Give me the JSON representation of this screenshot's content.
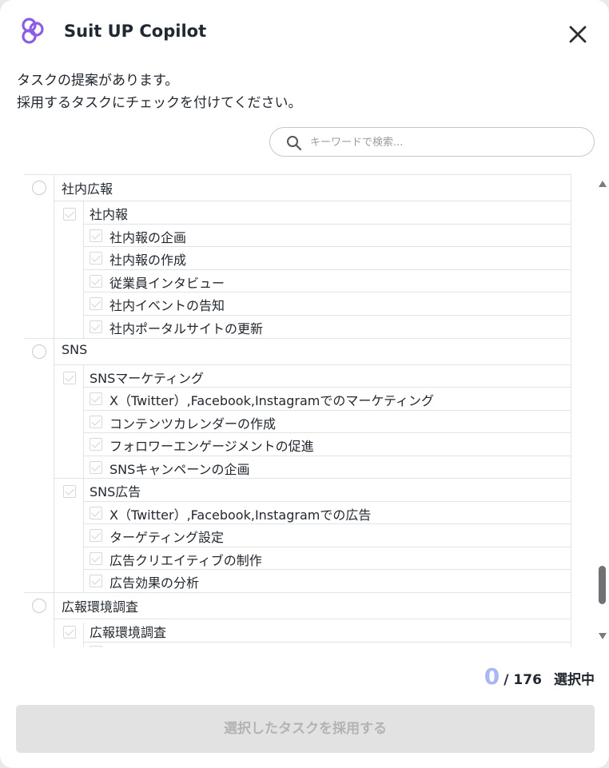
{
  "header": {
    "app_title": "Suit UP Copilot",
    "logo_icon": "suitup-logo-icon",
    "close_icon": "close-icon",
    "brand_color": "#8b5ce6"
  },
  "intro": {
    "line1": "タスクの提案があります。",
    "line2": "採用するタスクにチェックを付けてください。"
  },
  "search": {
    "placeholder": "キーワードで検索...",
    "value": ""
  },
  "categories": [
    {
      "label": "社内広報",
      "groups": [
        {
          "label": "社内報",
          "tasks": [
            "社内報の企画",
            "社内報の作成",
            "従業員インタビュー",
            "社内イベントの告知",
            "社内ポータルサイトの更新"
          ]
        }
      ]
    },
    {
      "label": "SNS",
      "groups": [
        {
          "label": "SNSマーケティング",
          "tasks": [
            "X（Twitter）,Facebook,Instagramでのマーケティング",
            "コンテンツカレンダーの作成",
            "フォロワーエンゲージメントの促進",
            "SNSキャンペーンの企画"
          ]
        },
        {
          "label": "SNS広告",
          "tasks": [
            "X（Twitter）,Facebook,Instagramでの広告",
            "ターゲティング設定",
            "広告クリエイティブの制作",
            "広告効果の分析"
          ]
        }
      ]
    },
    {
      "label": "広報環境調査",
      "groups": [
        {
          "label": "広報環境調査",
          "tasks": [
            ""
          ]
        }
      ]
    }
  ],
  "footer": {
    "selected_count": "0",
    "total": "/ 176",
    "selected_label": "選択中",
    "submit_label": "選択したタスクを採用する"
  }
}
